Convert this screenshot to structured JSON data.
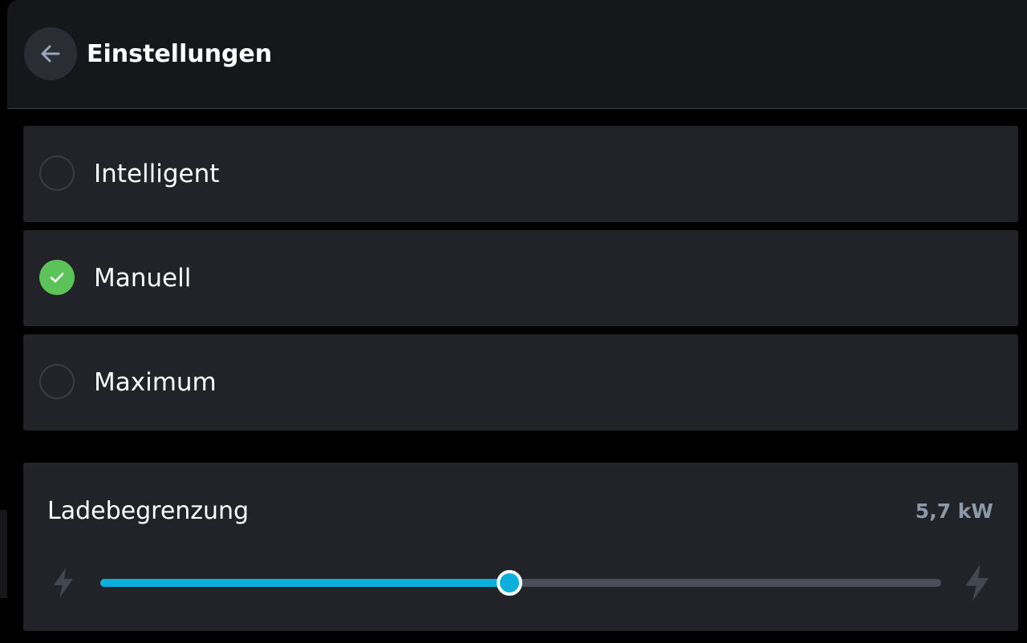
{
  "header": {
    "title": "Einstellungen",
    "back_icon": "arrow-left-icon"
  },
  "modes": [
    {
      "label": "Intelligent",
      "selected": false
    },
    {
      "label": "Manuell",
      "selected": true
    },
    {
      "label": "Maximum",
      "selected": false
    }
  ],
  "charge_limit": {
    "title": "Ladebegrenzung",
    "value_text": "5,7 kW",
    "slider_fraction": 0.487,
    "min_icon": "bolt-icon",
    "max_icon": "bolt-icon"
  },
  "colors": {
    "accent": "#0ab0db",
    "selected": "#5cc35a",
    "card": "#212328",
    "header": "#16171b"
  }
}
